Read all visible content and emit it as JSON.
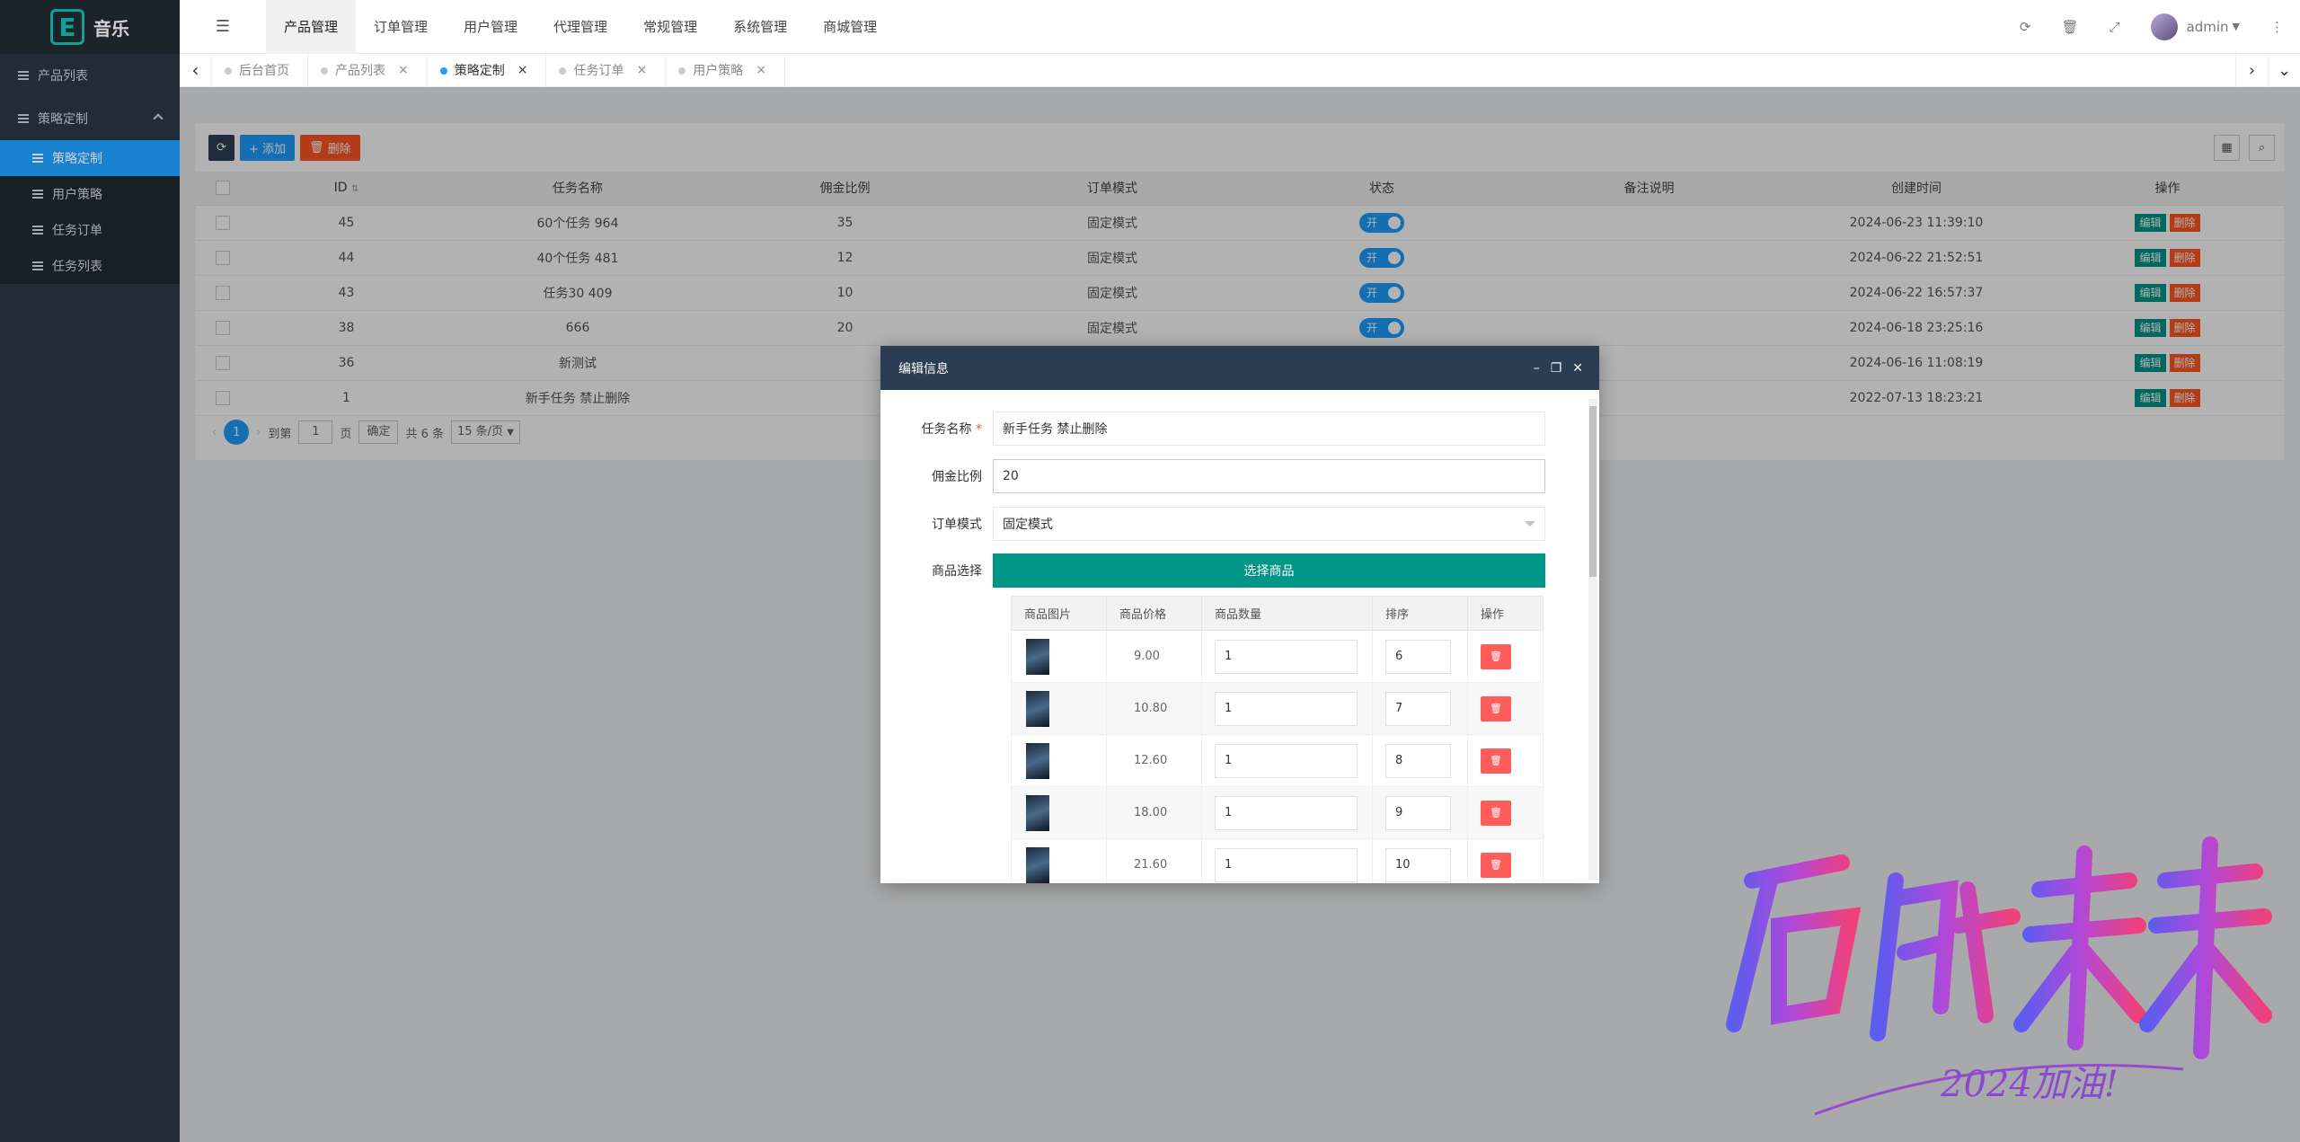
{
  "app": {
    "logo_letter": "E",
    "title": "音乐"
  },
  "sidebar": {
    "items": [
      {
        "label": "产品列表"
      },
      {
        "label": "策略定制"
      },
      {
        "label": "策略定制"
      },
      {
        "label": "用户策略"
      },
      {
        "label": "任务订单"
      },
      {
        "label": "任务列表"
      }
    ]
  },
  "topnav": {
    "items": [
      "产品管理",
      "订单管理",
      "用户管理",
      "代理管理",
      "常规管理",
      "系统管理",
      "商城管理"
    ],
    "user": "admin"
  },
  "tabs": [
    {
      "label": "后台首页"
    },
    {
      "label": "产品列表"
    },
    {
      "label": "策略定制"
    },
    {
      "label": "任务订单"
    },
    {
      "label": "用户策略"
    }
  ],
  "toolbar": {
    "add": "+ 添加",
    "delete": "删除"
  },
  "table": {
    "headers": [
      "ID",
      "任务名称",
      "佣金比例",
      "订单模式",
      "状态",
      "备注说明",
      "创建时间",
      "操作"
    ],
    "rows": [
      {
        "id": "45",
        "name": "60个任务 964",
        "rate": "35",
        "mode": "固定模式",
        "status": "开",
        "note": "",
        "time": "2024-06-23 11:39:10"
      },
      {
        "id": "44",
        "name": "40个任务 481",
        "rate": "12",
        "mode": "固定模式",
        "status": "开",
        "note": "",
        "time": "2024-06-22 21:52:51"
      },
      {
        "id": "43",
        "name": "任务30 409",
        "rate": "10",
        "mode": "固定模式",
        "status": "开",
        "note": "",
        "time": "2024-06-22 16:57:37"
      },
      {
        "id": "38",
        "name": "666",
        "rate": "20",
        "mode": "固定模式",
        "status": "开",
        "note": "",
        "time": "2024-06-18 23:25:16"
      },
      {
        "id": "36",
        "name": "新测试",
        "rate": "",
        "mode": "",
        "status": "",
        "note": "",
        "time": "2024-06-16 11:08:19"
      },
      {
        "id": "1",
        "name": "新手任务 禁止删除",
        "rate": "",
        "mode": "",
        "status": "",
        "note": "",
        "time": "2022-07-13 18:23:21"
      }
    ],
    "edit": "编辑",
    "del": "删除"
  },
  "pager": {
    "current": "1",
    "goto": "到第",
    "page_input": "1",
    "page_unit": "页",
    "confirm": "确定",
    "total": "共 6 条",
    "size": "15 条/页"
  },
  "modal": {
    "title": "编辑信息",
    "name_label": "任务名称",
    "name_value": "新手任务 禁止删除",
    "rate_label": "佣金比例",
    "rate_value": "20",
    "mode_label": "订单模式",
    "mode_value": "固定模式",
    "goods_label": "商品选择",
    "pick_btn": "选择商品",
    "goods_headers": [
      "商品图片",
      "商品价格",
      "商品数量",
      "排序",
      "操作"
    ],
    "goods": [
      {
        "price": "9.00",
        "qty": "1",
        "sort": "6"
      },
      {
        "price": "10.80",
        "qty": "1",
        "sort": "7"
      },
      {
        "price": "12.60",
        "qty": "1",
        "sort": "8"
      },
      {
        "price": "18.00",
        "qty": "1",
        "sort": "9"
      },
      {
        "price": "21.60",
        "qty": "1",
        "sort": "10"
      }
    ]
  },
  "colors": {
    "accent": "#1e9fff",
    "teal": "#009688",
    "danger": "#ff5722",
    "sidebar": "#2a3542"
  }
}
